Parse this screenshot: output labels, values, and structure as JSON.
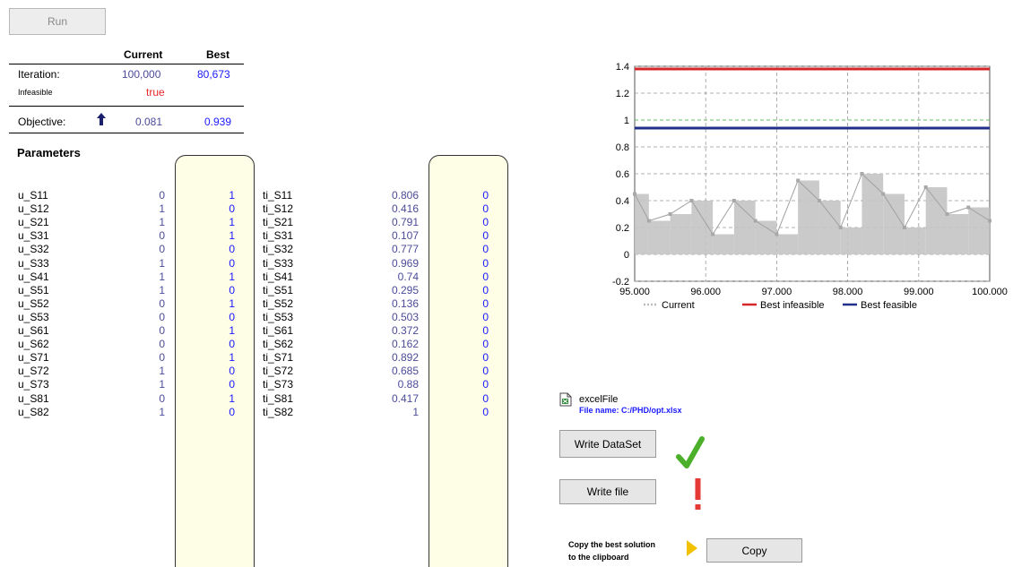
{
  "run_button": "Run",
  "table": {
    "col_current": "Current",
    "col_best": "Best",
    "iteration_label": "Iteration:",
    "iteration_current": "100,000",
    "iteration_best": "80,673",
    "infeasible_label": "Infeasible",
    "infeasible_value": "true",
    "objective_label": "Objective:",
    "objective_current": "0.081",
    "objective_best": "0.939"
  },
  "parameters_title": "Parameters",
  "params_u": [
    {
      "name": "u_S11",
      "current": "0",
      "best": "1"
    },
    {
      "name": "u_S12",
      "current": "1",
      "best": "0"
    },
    {
      "name": "u_S21",
      "current": "1",
      "best": "1"
    },
    {
      "name": "u_S31",
      "current": "0",
      "best": "1"
    },
    {
      "name": "u_S32",
      "current": "0",
      "best": "0"
    },
    {
      "name": "u_S33",
      "current": "1",
      "best": "0"
    },
    {
      "name": "u_S41",
      "current": "1",
      "best": "1"
    },
    {
      "name": "u_S51",
      "current": "1",
      "best": "0"
    },
    {
      "name": "u_S52",
      "current": "0",
      "best": "1"
    },
    {
      "name": "u_S53",
      "current": "0",
      "best": "0"
    },
    {
      "name": "u_S61",
      "current": "0",
      "best": "1"
    },
    {
      "name": "u_S62",
      "current": "0",
      "best": "0"
    },
    {
      "name": "u_S71",
      "current": "0",
      "best": "1"
    },
    {
      "name": "u_S72",
      "current": "1",
      "best": "0"
    },
    {
      "name": "u_S73",
      "current": "1",
      "best": "0"
    },
    {
      "name": "u_S81",
      "current": "0",
      "best": "1"
    },
    {
      "name": "u_S82",
      "current": "1",
      "best": "0"
    }
  ],
  "params_ti": [
    {
      "name": "ti_S11",
      "current": "0.806",
      "best": "0"
    },
    {
      "name": "ti_S12",
      "current": "0.416",
      "best": "0"
    },
    {
      "name": "ti_S21",
      "current": "0.791",
      "best": "0"
    },
    {
      "name": "ti_S31",
      "current": "0.107",
      "best": "0"
    },
    {
      "name": "ti_S32",
      "current": "0.777",
      "best": "0"
    },
    {
      "name": "ti_S33",
      "current": "0.969",
      "best": "0"
    },
    {
      "name": "ti_S41",
      "current": "0.74",
      "best": "0"
    },
    {
      "name": "ti_S51",
      "current": "0.295",
      "best": "0"
    },
    {
      "name": "ti_S52",
      "current": "0.136",
      "best": "0"
    },
    {
      "name": "ti_S53",
      "current": "0.503",
      "best": "0"
    },
    {
      "name": "ti_S61",
      "current": "0.372",
      "best": "0"
    },
    {
      "name": "ti_S62",
      "current": "0.162",
      "best": "0"
    },
    {
      "name": "ti_S71",
      "current": "0.892",
      "best": "0"
    },
    {
      "name": "ti_S72",
      "current": "0.685",
      "best": "0"
    },
    {
      "name": "ti_S73",
      "current": "0.88",
      "best": "0"
    },
    {
      "name": "ti_S81",
      "current": "0.417",
      "best": "0"
    },
    {
      "name": "ti_S82",
      "current": "1",
      "best": "0"
    }
  ],
  "chart_data": {
    "type": "line",
    "x_ticks": [
      "95.000",
      "96.000",
      "97.000",
      "98.000",
      "99.000",
      "100.000"
    ],
    "y_ticks": [
      "1.4",
      "1.2",
      "1",
      "0.8",
      "0.6",
      "0.4",
      "0.2",
      "0",
      "-0.2"
    ],
    "xlim": [
      95000,
      100000
    ],
    "ylim": [
      -0.2,
      1.4
    ],
    "series": [
      {
        "name": "Current",
        "style": "dotted-gray",
        "color": "#bdbdbd",
        "x": [
          95000,
          95200,
          95500,
          95800,
          96100,
          96400,
          96700,
          97000,
          97300,
          97600,
          97900,
          98200,
          98500,
          98800,
          99100,
          99400,
          99700,
          100000
        ],
        "values": [
          0.45,
          0.25,
          0.3,
          0.4,
          0.15,
          0.4,
          0.25,
          0.15,
          0.55,
          0.4,
          0.2,
          0.6,
          0.45,
          0.2,
          0.5,
          0.3,
          0.35,
          0.25
        ]
      },
      {
        "name": "Best infeasible",
        "color": "#d62728",
        "x": [
          95000,
          100000
        ],
        "values": [
          1.38,
          1.38
        ]
      },
      {
        "name": "Best feasible",
        "color": "#1f2f8a",
        "x": [
          95000,
          100000
        ],
        "values": [
          0.94,
          0.94
        ]
      }
    ],
    "grid": true,
    "legend_position": "bottom"
  },
  "excel": {
    "title": "excelFile",
    "file_label": "File name: C:/PHD/opt.xlsx"
  },
  "buttons": {
    "write_dataset": "Write DataSet",
    "write_file": "Write file",
    "copy": "Copy"
  },
  "copy_hint_line1": "Copy the best solution",
  "copy_hint_line2": "to the clipboard",
  "colors": {
    "blue_value": "#1a1aff",
    "navy_value": "#4b4b9a",
    "red_value": "#e8262b",
    "check_green": "#4caf2a",
    "warning_red": "#e53935",
    "box_fill": "#fefde6",
    "arrow_yellow": "#f2c200"
  }
}
